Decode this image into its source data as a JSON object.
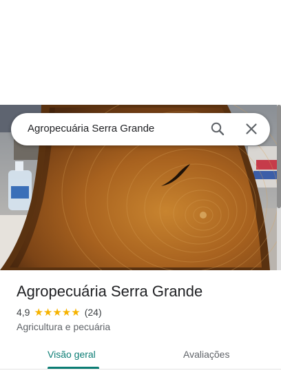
{
  "search": {
    "query": "Agropecuária Serra Grande"
  },
  "icons": {
    "search": "search-icon",
    "close": "close-icon"
  },
  "place": {
    "name": "Agropecuária Serra Grande",
    "rating": "4,9",
    "stars": "★★★★★",
    "review_count": "(24)",
    "category": "Agricultura e pecuária"
  },
  "tabs": [
    {
      "label": "Visão geral",
      "selected": true
    },
    {
      "label": "Avaliações",
      "selected": false
    }
  ],
  "colors": {
    "accent": "#0b7d74",
    "star": "#f6b300",
    "text_primary": "#202124",
    "text_secondary": "#5f6368"
  }
}
